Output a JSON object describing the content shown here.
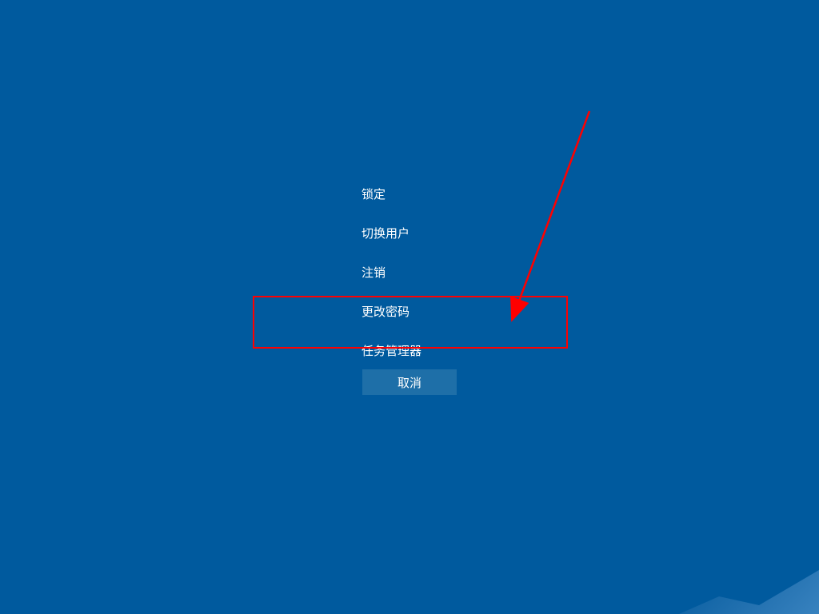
{
  "menu": {
    "items": [
      {
        "label": "锁定",
        "name": "lock-option"
      },
      {
        "label": "切换用户",
        "name": "switch-user-option"
      },
      {
        "label": "注销",
        "name": "sign-out-option"
      },
      {
        "label": "更改密码",
        "name": "change-password-option"
      },
      {
        "label": "任务管理器",
        "name": "task-manager-option"
      }
    ]
  },
  "cancel": {
    "label": "取消"
  },
  "annotation": {
    "arrow_color": "#ff0000",
    "box_color": "#ff0000"
  }
}
